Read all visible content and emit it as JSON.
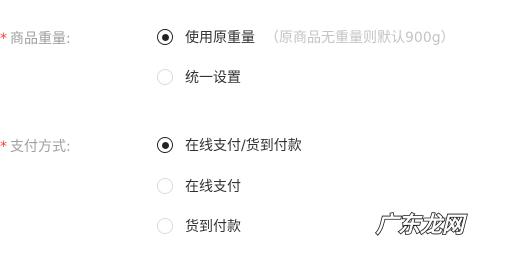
{
  "weight_field": {
    "required_mark": "*",
    "label": "商品重量:",
    "options": [
      {
        "label": "使用原重量",
        "hint": "（原商品无重量则默认900g）",
        "checked": true
      },
      {
        "label": "统一设置",
        "checked": false
      }
    ]
  },
  "payment_field": {
    "required_mark": "*",
    "label": "支付方式:",
    "options": [
      {
        "label": "在线支付/货到付款",
        "checked": true
      },
      {
        "label": "在线支付",
        "checked": false
      },
      {
        "label": "货到付款",
        "checked": false
      }
    ]
  },
  "watermark": {
    "text": "广东龙网"
  },
  "colors": {
    "required": "#ff3b3b",
    "label": "#a0a0a0",
    "text": "#333333",
    "hint": "#c4c4c4",
    "radio_checked": "#222222",
    "radio_border": "#dcdcdc"
  }
}
